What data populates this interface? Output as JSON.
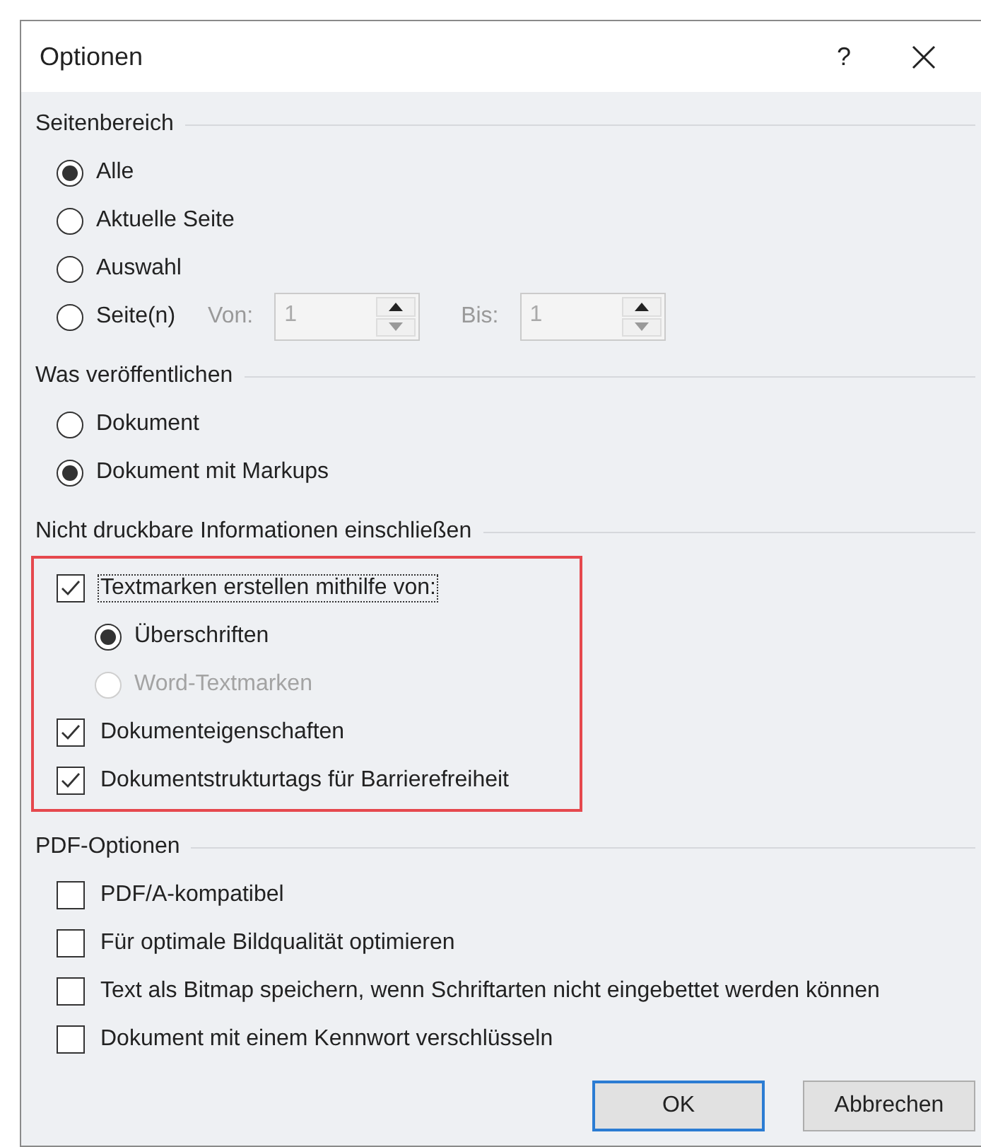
{
  "window": {
    "title": "Optionen",
    "help": "?"
  },
  "sections": [
    {
      "title": "Seitenbereich",
      "highlighted": false,
      "items": [
        {
          "kind": "radio",
          "label": "Alle",
          "selected": true,
          "disabled": false
        },
        {
          "kind": "radio",
          "label": "Aktuelle Seite",
          "selected": false,
          "disabled": false
        },
        {
          "kind": "radio",
          "label": "Auswahl",
          "selected": false,
          "disabled": false
        },
        {
          "kind": "range",
          "label": "Seite(n)",
          "selected": false,
          "disabled": false,
          "fields": [
            {
              "label": "Von:",
              "value": "1",
              "disabled": true
            },
            {
              "label": "Bis:",
              "value": "1",
              "disabled": true
            }
          ]
        }
      ]
    },
    {
      "title": "Was veröffentlichen",
      "highlighted": false,
      "items": [
        {
          "kind": "radio",
          "label": "Dokument",
          "selected": false,
          "disabled": false
        },
        {
          "kind": "radio",
          "label": "Dokument mit Markups",
          "selected": true,
          "disabled": false
        }
      ]
    },
    {
      "title": "Nicht druckbare Informationen einschließen",
      "highlighted": true,
      "items": [
        {
          "kind": "checkbox",
          "label": "Textmarken erstellen mithilfe von:",
          "checked": true,
          "focused": true,
          "children": [
            {
              "kind": "radio",
              "label": "Überschriften",
              "selected": true,
              "disabled": false
            },
            {
              "kind": "radio",
              "label": "Word-Textmarken",
              "selected": false,
              "disabled": true
            }
          ]
        },
        {
          "kind": "checkbox",
          "label": "Dokumenteigenschaften",
          "checked": true,
          "focused": false
        },
        {
          "kind": "checkbox",
          "label": "Dokumentstrukturtags für Barrierefreiheit",
          "checked": true,
          "focused": false
        }
      ]
    },
    {
      "title": "PDF-Optionen",
      "highlighted": false,
      "items": [
        {
          "kind": "checkbox",
          "label": "PDF/A-kompatibel",
          "checked": false,
          "focused": false
        },
        {
          "kind": "checkbox",
          "label": "Für optimale Bildqualität optimieren",
          "checked": false,
          "focused": false
        },
        {
          "kind": "checkbox",
          "label": "Text als Bitmap speichern, wenn Schriftarten nicht eingebettet werden können",
          "checked": false,
          "focused": false
        },
        {
          "kind": "checkbox",
          "label": "Dokument mit einem Kennwort verschlüsseln",
          "checked": false,
          "focused": false
        }
      ]
    }
  ],
  "buttons": [
    {
      "label": "OK",
      "default": true
    },
    {
      "label": "Abbrechen",
      "default": false
    }
  ]
}
